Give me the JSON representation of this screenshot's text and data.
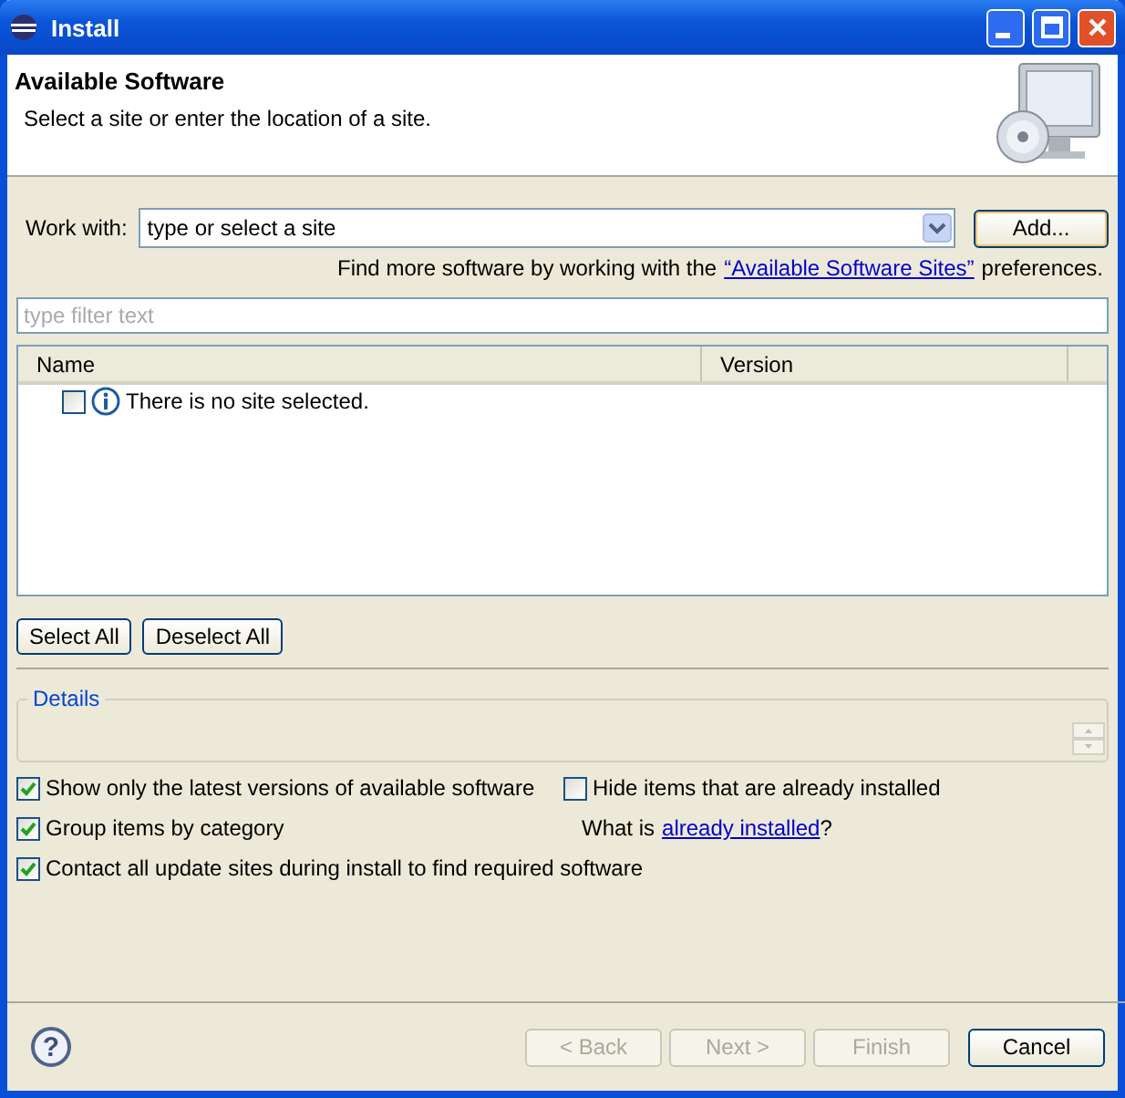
{
  "window": {
    "title": "Install"
  },
  "header": {
    "title": "Available Software",
    "description": "Select a site or enter the location of a site."
  },
  "work_with": {
    "label": "Work with:",
    "value": "type or select a site",
    "add_button": "Add...",
    "hint_before": "Find more software by working with the",
    "hint_link": "“Available Software Sites”",
    "hint_after": "preferences."
  },
  "filter": {
    "placeholder": "type filter text"
  },
  "table": {
    "columns": [
      "Name",
      "Version"
    ],
    "rows": [
      {
        "checked": false,
        "text": "There is no site selected."
      }
    ]
  },
  "select_buttons": [
    "Select All",
    "Deselect All"
  ],
  "details": {
    "title": "Details"
  },
  "options": [
    {
      "label": "Show only the latest versions of available software",
      "checked": true
    },
    {
      "label": "Hide items that are already installed",
      "checked": false
    },
    {
      "label": "Group items by category",
      "checked": true
    },
    {
      "label": "Contact all update sites during install to find required software",
      "checked": true
    }
  ],
  "installed_hint": {
    "before": "What is",
    "link": "already installed",
    "after": "?"
  },
  "help_button": {
    "label": "?"
  },
  "buttons": [
    {
      "label": "< Back",
      "disabled": true
    },
    {
      "label": "Next >",
      "disabled": true
    },
    {
      "label": "Finish",
      "disabled": true
    },
    {
      "label": "Cancel",
      "disabled": false
    }
  ]
}
